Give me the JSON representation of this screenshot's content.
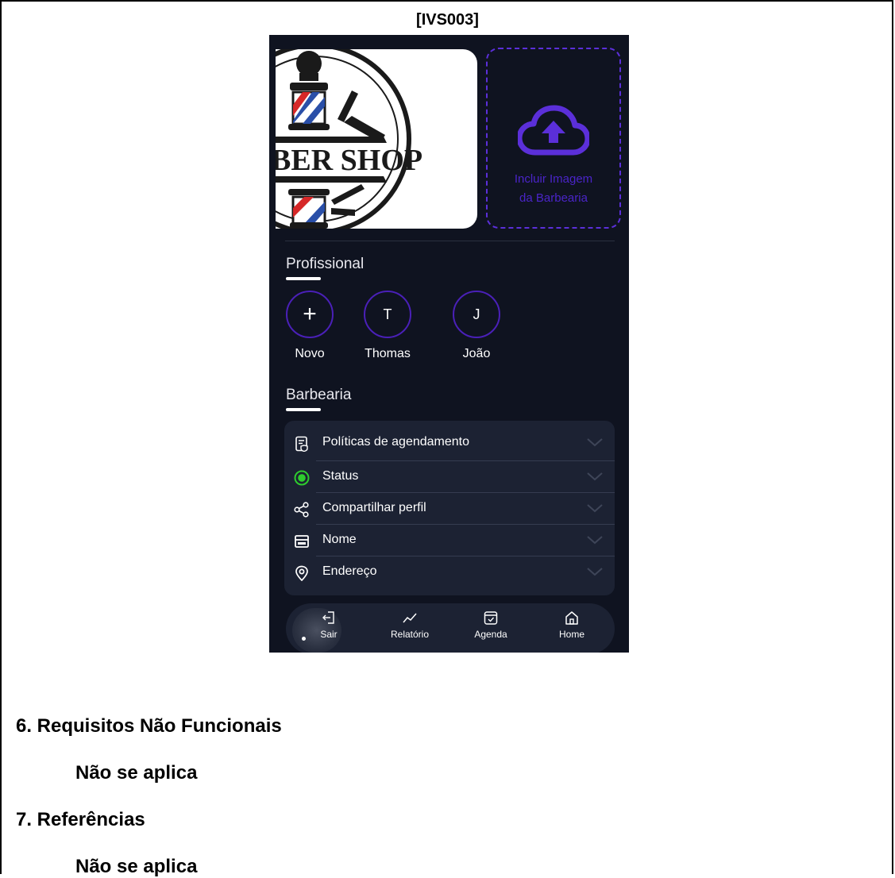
{
  "doc": {
    "title": "[IVS003]",
    "section6_heading": "6. Requisitos Não Funcionais",
    "section6_body": "Não se aplica",
    "section7_heading": "7. Referências",
    "section7_body": "Não se aplica"
  },
  "app": {
    "logo_text": "BER SHOP",
    "upload_label_line1": "Incluir Imagem",
    "upload_label_line2": "da Barbearia",
    "professional_title": "Profissional",
    "professionals": [
      {
        "initial": "+",
        "name": "Novo"
      },
      {
        "initial": "T",
        "name": "Thomas"
      },
      {
        "initial": "J",
        "name": "João"
      }
    ],
    "barbershop_title": "Barbearia",
    "settings": [
      {
        "label": "Políticas de agendamento",
        "icon": "policy-icon"
      },
      {
        "label": "Status",
        "icon": "status-radio-icon"
      },
      {
        "label": "Compartilhar perfil",
        "icon": "share-icon"
      },
      {
        "label": "Nome",
        "icon": "storefront-icon"
      },
      {
        "label": "Endereço",
        "icon": "location-pin-icon"
      }
    ],
    "nav": [
      {
        "label": "Sair",
        "icon": "logout-icon"
      },
      {
        "label": "Relatório",
        "icon": "chart-line-icon"
      },
      {
        "label": "Agenda",
        "icon": "calendar-icon"
      },
      {
        "label": "Home",
        "icon": "home-icon"
      }
    ],
    "colors": {
      "background": "#0f1320",
      "panel": "#1c2233",
      "accent": "#5b2fd9",
      "status_green": "#2ecc2e"
    }
  }
}
